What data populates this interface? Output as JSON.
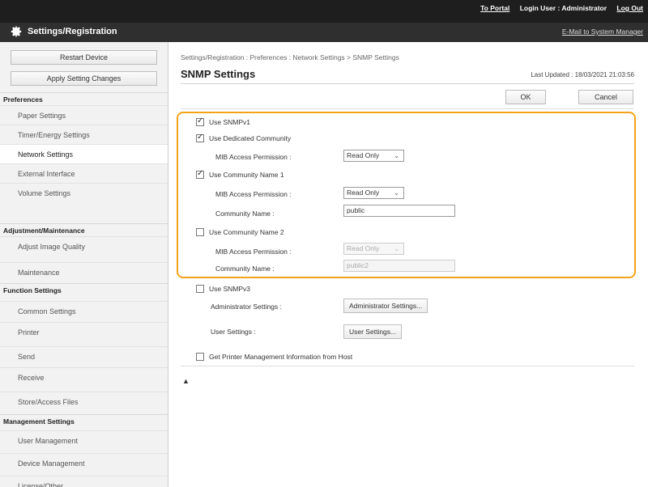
{
  "header": {
    "portal": "To Portal",
    "login_user": "Login User : Administrator",
    "logout": "Log Out",
    "title": "Settings/Registration",
    "mail_link": "E-Mail to System Manager"
  },
  "sidebar": {
    "restart_button": "Restart Device",
    "apply_button": "Apply Setting Changes",
    "sections": [
      {
        "header": "Preferences",
        "items": [
          "Paper Settings",
          "Timer/Energy Settings",
          "Network Settings",
          "External Interface",
          "Volume Settings"
        ]
      },
      {
        "header": "Adjustment/Maintenance",
        "items": [
          "Adjust Image Quality",
          "Maintenance"
        ]
      },
      {
        "header": "Function Settings",
        "items": [
          "Common Settings",
          "Printer",
          "Send",
          "Receive",
          "Store/Access Files"
        ]
      },
      {
        "header": "Management Settings",
        "items": [
          "User Management",
          "Device Management",
          "License/Other"
        ]
      }
    ],
    "active_item": "Network Settings"
  },
  "main": {
    "breadcrumb": "Settings/Registration : Preferences : Network Settings > SNMP Settings",
    "title": "SNMP Settings",
    "last_updated": "Last Updated : 18/03/2021 21:03:56",
    "ok_label": "OK",
    "cancel_label": "Cancel",
    "use_snmpv1": "Use SNMPv1",
    "use_dedicated_community": "Use Dedicated Community",
    "mib_access_label": "MIB Access Permission :",
    "dedicated_permission": "Read Only",
    "use_community_1": "Use Community Name 1",
    "community_1_permission": "Read Only",
    "community_name_label": "Community Name :",
    "community_1_name": "public",
    "use_community_2": "Use Community Name 2",
    "community_2_permission": "Read Only",
    "community_2_name": "public2",
    "use_snmpv3": "Use SNMPv3",
    "admin_settings_label": "Administrator Settings :",
    "admin_settings_button": "Administrator Settings...",
    "user_settings_label": "User Settings :",
    "user_settings_button": "User Settings...",
    "get_printer_info": "Get Printer Management Information from Host",
    "to_top": "▲"
  },
  "colors": {
    "highlight": "#f5a21a",
    "topbar": "#1e1e1e"
  }
}
